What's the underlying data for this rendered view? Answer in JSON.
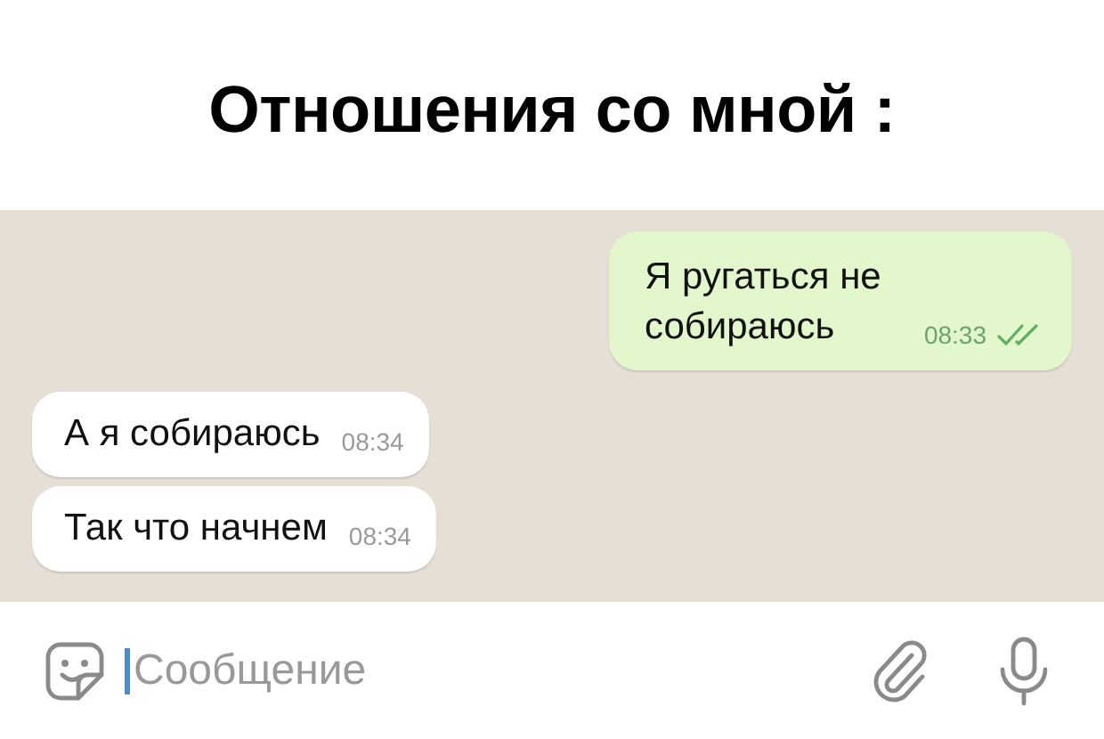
{
  "caption": "Отношения со мной :",
  "messages": [
    {
      "kind": "outgoing",
      "text": "Я ругаться не собираюсь",
      "time": "08:33",
      "read": true
    },
    {
      "kind": "incoming",
      "text": "А я собираюсь",
      "time": "08:34"
    },
    {
      "kind": "incoming",
      "text": "Так что начнем",
      "time": "08:34"
    }
  ],
  "composer": {
    "placeholder": "Сообщение"
  }
}
